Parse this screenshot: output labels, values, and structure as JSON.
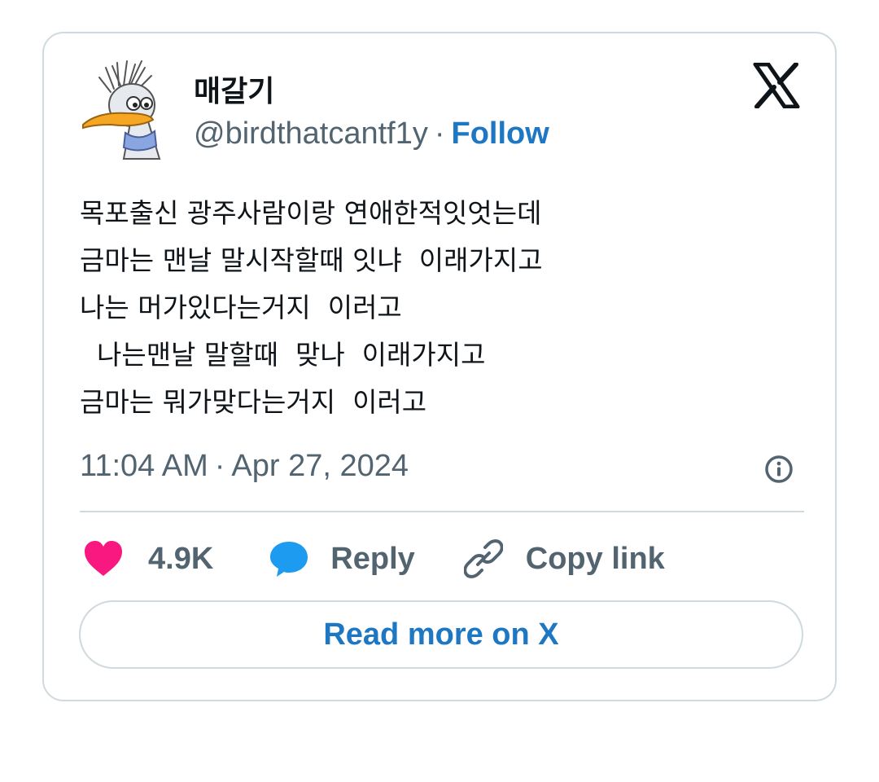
{
  "tweet": {
    "author": {
      "display_name": "매갈기",
      "handle": "@birdthatcantf1y",
      "separator": "·",
      "follow_label": "Follow",
      "avatar_icon": "cartoon-bird-avatar"
    },
    "platform_icon": "x-logo-icon",
    "text_lines": [
      "목포출신 광주사람이랑 연애한적잇엇는데",
      "금마는 맨날 말시작할때 잇냐  이래가지고",
      "나는 머가있다는거지  이러고",
      "  나는맨날 말할때  맞나  이래가지고",
      "금마는 뭐가맞다는거지  이러고"
    ],
    "time": "11:04 AM",
    "time_separator": "·",
    "date": "Apr 27, 2024",
    "info_icon": "info-icon",
    "actions": {
      "like_count": "4.9K",
      "like_icon": "heart-icon",
      "reply_label": "Reply",
      "reply_icon": "speech-bubble-icon",
      "copy_link_label": "Copy link",
      "copy_link_icon": "link-icon"
    },
    "read_more_label": "Read more on X"
  },
  "colors": {
    "link_blue": "#1d77c3",
    "heart_pink": "#f91880",
    "reply_blue": "#1d9bf0",
    "muted_text": "#536471",
    "border": "#cfd9de",
    "text": "#0f1419"
  }
}
